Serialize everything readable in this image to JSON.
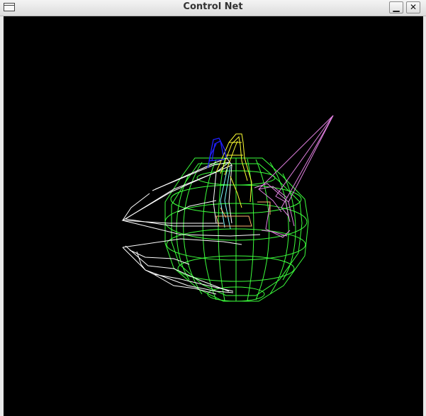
{
  "window": {
    "title": "Control Net",
    "minimize_glyph": "▁",
    "close_glyph": "✕"
  },
  "icons": {
    "window_menu": "window-menu-icon",
    "minimize": "minimize-icon",
    "close": "close-icon"
  },
  "colors": {
    "canvas_background": "#000000",
    "mesh_green": "#3cff3c",
    "mesh_white": "#ffffff",
    "mesh_yellow": "#ffff33",
    "mesh_blue": "#2020ff",
    "mesh_violet": "#e080e0",
    "mesh_cyan": "#80ffff",
    "mesh_orange": "#ffb070"
  }
}
